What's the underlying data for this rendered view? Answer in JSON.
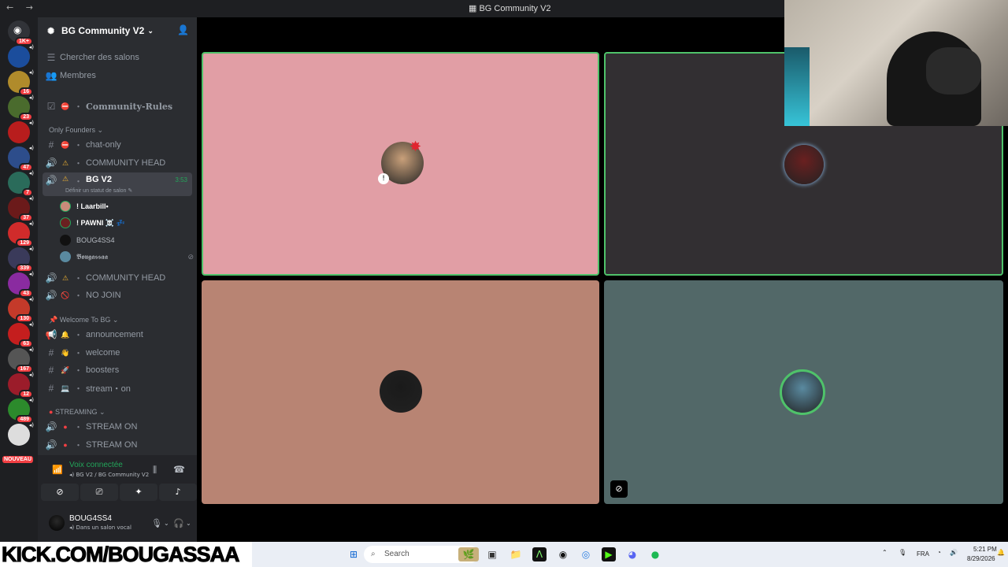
{
  "window": {
    "title": "BG Community V2",
    "nav": "← →"
  },
  "servers": {
    "dm_badge": "1K+",
    "items": [
      {
        "badge": "",
        "color": "#1b4d9c"
      },
      {
        "badge": "16",
        "color": "#b08b2b"
      },
      {
        "badge": "23",
        "color": "#4a6b2d"
      },
      {
        "badge": "",
        "color": "#b81d1d"
      },
      {
        "badge": "47",
        "color": "#2d4d8b"
      },
      {
        "badge": "7",
        "color": "#2a6b5a"
      },
      {
        "badge": "37",
        "color": "#6b1a1a"
      },
      {
        "badge": "129",
        "color": "#d02b2b"
      },
      {
        "badge": "339",
        "color": "#3a3a5a"
      },
      {
        "badge": "43",
        "color": "#8a2ba0"
      },
      {
        "badge": "130",
        "color": "#c43a2a"
      },
      {
        "badge": "63",
        "color": "#c41e1e"
      },
      {
        "badge": "167",
        "color": "#555555"
      },
      {
        "badge": "12",
        "color": "#9b1c2a"
      },
      {
        "badge": "489",
        "color": "#2c8a2c"
      },
      {
        "badge": "",
        "color": "#dddddd"
      }
    ],
    "nouveau": "NOUVEAU"
  },
  "guild": {
    "name": "BG Community V2"
  },
  "sidebar": {
    "search": "Chercher des salons",
    "members": "Membres",
    "rules": "Community-Rules",
    "cat_founders": "Only Founders",
    "chat_only": "chat-only",
    "community_head": "COMMUNITY HEAD",
    "bgv2": "BG V2",
    "bgv2_time": "3:53",
    "bgv2_status": "Définir un statut de salon",
    "users": [
      "! Laarbill•",
      "! PAWNI ☠️ 💤",
      "BOUG4SS4",
      "𝕭𝖔𝖚𝖌𝖆𝖘𝖘𝖆𝖆"
    ],
    "community_head2": "COMMUNITY HEAD",
    "no_join": "NO JOIN",
    "cat_welcome": "Welcome To BG",
    "announcement": "announcement",
    "welcome": "welcome",
    "boosters": "boosters",
    "stream_on_text": "stream・on",
    "cat_streaming": "STREAMING",
    "stream_on1": "STREAM ON",
    "stream_on2": "STREAM ON"
  },
  "voice": {
    "title": "Voix connectée",
    "sub": "BG V2 / BG Community V2"
  },
  "user": {
    "name": "BOUG4SS4",
    "status": "Dans un salon vocal"
  },
  "tiles": [
    {
      "bg": "#e19ea5",
      "border": "#4fc26a",
      "avatar": "#c9a07a"
    },
    {
      "bg": "#322f32",
      "border": "#4fc26a",
      "avatar": "#6a2020"
    },
    {
      "bg": "#b88473",
      "border": "",
      "avatar": "#1a1a1a"
    },
    {
      "bg": "#526868",
      "border": "",
      "avatar": "#5a8aa0"
    }
  ],
  "overlay": {
    "kick": "KICK.COM/BOUGASSAA"
  },
  "taskbar": {
    "search": "Search",
    "lang": "FRA",
    "time": "5:21 PM",
    "date": "8/29/2026"
  }
}
